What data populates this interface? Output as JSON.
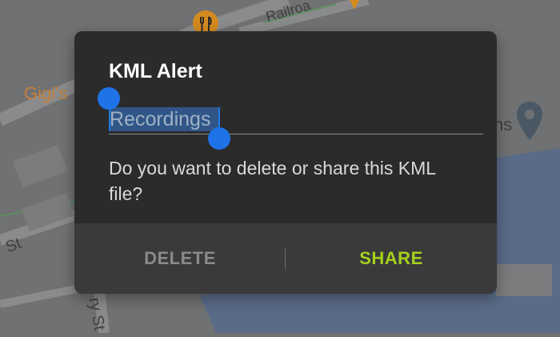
{
  "map": {
    "labels": {
      "gigis": "Gigi's",
      "railroad": "Railroa",
      "ns": "ns",
      "st_left": "St",
      "ry_st": "ry St"
    }
  },
  "dialog": {
    "title": "KML Alert",
    "input_value": "Recordings",
    "message": "Do you want to delete or share this KML file?",
    "delete_label": "DELETE",
    "share_label": "SHARE"
  },
  "colors": {
    "accent": "#a5d11c",
    "selection_handle": "#1e73e8",
    "dialog_bg": "#2b2b2c"
  },
  "icons": [
    "restaurant-pin-icon",
    "location-pin-icon",
    "selection-handle-icon"
  ]
}
